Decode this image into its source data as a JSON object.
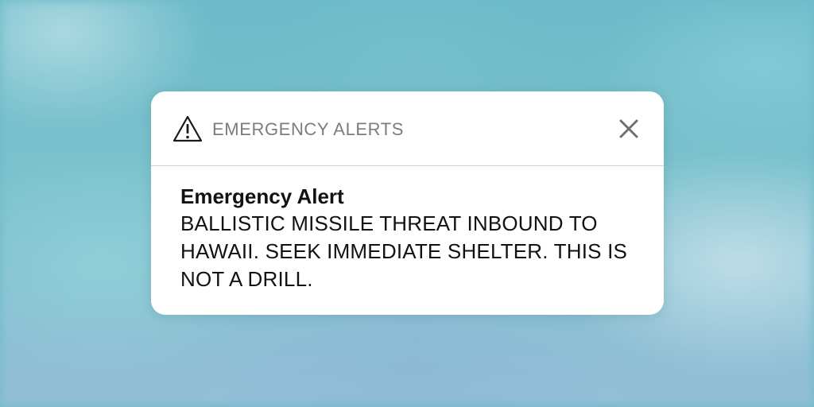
{
  "notification": {
    "app_name": "EMERGENCY ALERTS",
    "header_icon": "warning-triangle-icon",
    "close_icon": "close-icon",
    "title": "Emergency Alert",
    "message": "BALLISTIC MISSILE THREAT INBOUND TO HAWAII. SEEK IMMEDIATE SHELTER. THIS IS NOT A DRILL."
  },
  "colors": {
    "card_background": "#ffffff",
    "header_text": "#7a7d80",
    "body_text": "#121212",
    "divider": "#cfd3d6",
    "wallpaper_teal": "#6fb9c9"
  }
}
